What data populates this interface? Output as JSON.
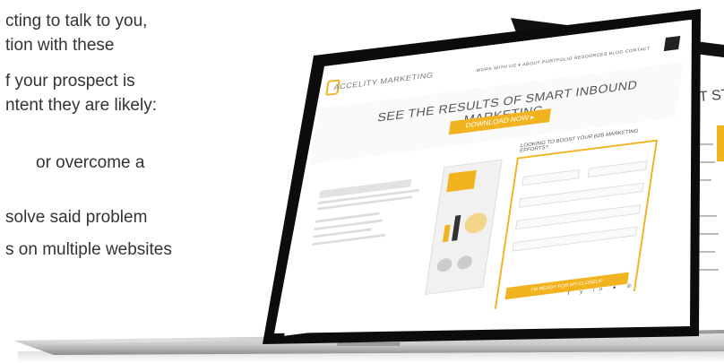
{
  "article": {
    "lines": [
      "cting to talk to you,",
      "tion with these",
      "f your prospect is",
      "ntent they are likely:",
      " or overcome a",
      "solve said problem",
      "s on multiple websites"
    ]
  },
  "laptop_front": {
    "brand": "ACCELITY MARKETING",
    "nav": "WORK WITH US ▾   ABOUT   PORTFOLIO   RESOURCES   BLOG   CONTACT",
    "headline": "SEE THE RESULTS OF SMART INBOUND MARKETING.",
    "cta": "DOWNLOAD NOW ▸",
    "form_title": "LOOKING TO BOOST YOUR B2B MARKETING EFFORTS?",
    "submit": "I'M READY FOR MY CLOSEUP",
    "social": "f y in ● ◎"
  },
  "laptop_back": {
    "headline_partial": "ST STEP"
  },
  "colors": {
    "accent": "#f2b321",
    "bezel": "#111111",
    "body_text": "#333333"
  }
}
